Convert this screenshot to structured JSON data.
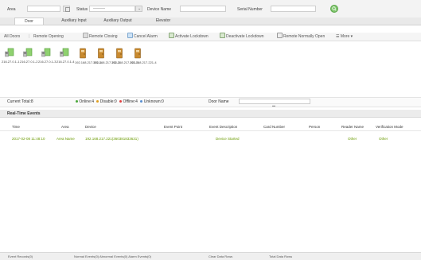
{
  "filters": {
    "area_label": "Area",
    "status_label": "Status",
    "status_value": "———",
    "device_name_label": "Device Name",
    "serial_number_label": "Serial Number"
  },
  "tabs": [
    {
      "label": "Door",
      "active": true
    },
    {
      "label": "Auxiliary Input",
      "active": false
    },
    {
      "label": "Auxiliary Output",
      "active": false
    },
    {
      "label": "Elevator",
      "active": false
    }
  ],
  "toolbar": {
    "all_doors": "All Doors",
    "remote_opening": "Remote Opening",
    "remote_closing": "Remote Closing",
    "cancel_alarm": "Cancel Alarm",
    "activate_lockdown": "Activate Lockdown",
    "deactivate_lockdown": "Deactivate Lockdown",
    "remote_normally_open": "Remote Normally Open",
    "more": "More"
  },
  "doors": [
    {
      "label": "216.27.0.1-1",
      "type": "green"
    },
    {
      "label": "216.27.0.1-2",
      "type": "green"
    },
    {
      "label": "216.27.0.1-3",
      "type": "green"
    },
    {
      "label": "216.27.0.1-4",
      "type": "green"
    },
    {
      "label": "192.168.217.221-1",
      "type": "orange"
    },
    {
      "label": "192.168.217.221-2",
      "type": "orange"
    },
    {
      "label": "192.168.217.221-3",
      "type": "orange"
    },
    {
      "label": "192.168.217.221-4",
      "type": "orange"
    }
  ],
  "status": {
    "current_total": "Current Total:8",
    "online": "Online:4",
    "disable": "Disable:0",
    "offline": "Offline:4",
    "unknown": "Unknown:0",
    "door_name_label": "Door Name",
    "online_color": "#4aa83a",
    "disable_color": "#e0a020",
    "offline_color": "#e04040",
    "unknown_color": "#5a8fd0"
  },
  "events": {
    "title": "Real-Time Events",
    "columns": [
      "Time",
      "Area",
      "Device",
      "Event Point",
      "Event Description",
      "Card Number",
      "Person",
      "Reader Name",
      "Verification Mode"
    ],
    "rows": [
      [
        "2017-02-08 11:48:10",
        "Area Name",
        "192.168.217.221(360381833631)",
        "",
        "Device Started",
        "",
        "",
        "Other",
        "Other"
      ]
    ]
  },
  "footer": [
    "Event Records(0)",
    "Normal Events(0) Abnormal Events(0) Alarm Events(0)",
    "Clear Data Rows",
    "Total Data Rows"
  ]
}
